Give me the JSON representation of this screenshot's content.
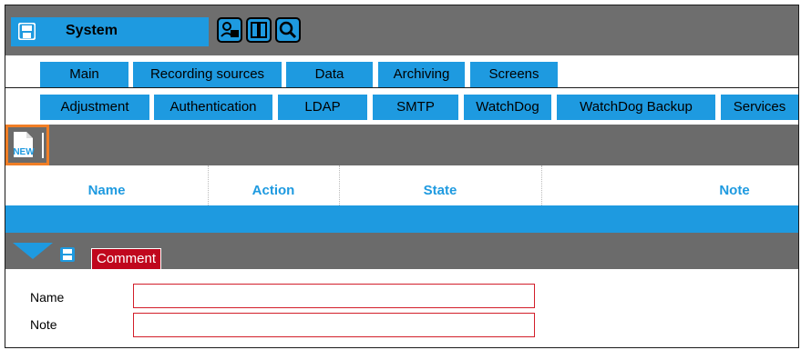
{
  "header": {
    "title": "System",
    "app_icon": "floppy-save-icon",
    "toolbar_icons": [
      "user-camera-icon",
      "split-view-icon",
      "search-icon"
    ]
  },
  "tabs_row1": [
    {
      "label": "Main"
    },
    {
      "label": "Recording sources"
    },
    {
      "label": "Data"
    },
    {
      "label": "Archiving"
    },
    {
      "label": "Screens"
    }
  ],
  "tabs_row2": [
    {
      "label": "Adjustment"
    },
    {
      "label": "Authentication"
    },
    {
      "label": "LDAP"
    },
    {
      "label": "SMTP"
    },
    {
      "label": "WatchDog"
    },
    {
      "label": "WatchDog Backup"
    },
    {
      "label": "Services"
    }
  ],
  "grid_toolbar": {
    "new_label": "NEW"
  },
  "grid": {
    "columns": [
      "Name",
      "Action",
      "State",
      "Note"
    ],
    "rows": []
  },
  "detail": {
    "tab_label": "Comment",
    "fields": [
      {
        "label": "Name",
        "value": ""
      },
      {
        "label": "Note",
        "value": ""
      }
    ]
  },
  "colors": {
    "accent": "#1e9ae0",
    "toolbar_gray": "#6b6b6b",
    "highlight_orange": "#f07e26",
    "comment_red": "#c0071d",
    "input_border": "#d21e2a"
  }
}
